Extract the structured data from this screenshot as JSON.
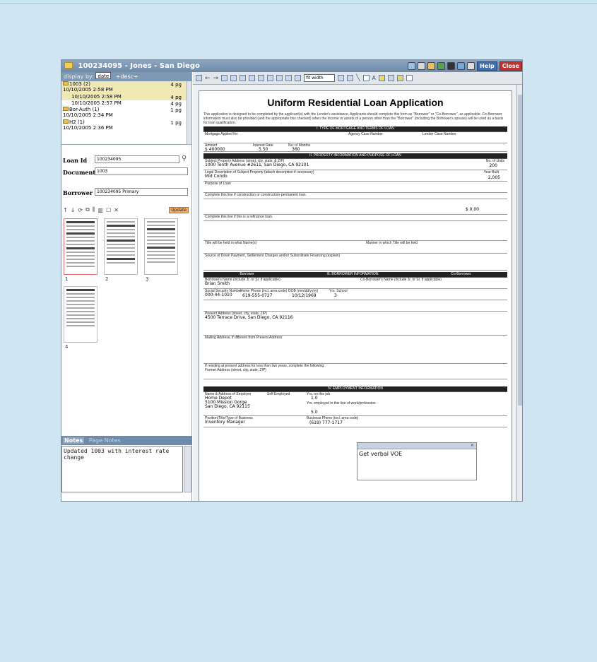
{
  "window": {
    "title": "100234095 - Jones - San Diego",
    "help_label": "Help",
    "close_label": "Close"
  },
  "display_bar": {
    "label": "display by:",
    "sort_value": "date",
    "order_label": "+desc+"
  },
  "documents": [
    {
      "name": "1003 (2)",
      "date": "10/10/2005 2:58 PM",
      "pages": "4 pg"
    },
    {
      "name": "10/10/2005 2:58 PM",
      "pages": "4 pg",
      "sub": true
    },
    {
      "name": "10/10/2005 2:57 PM",
      "pages": "4 pg",
      "sub": true
    },
    {
      "name": "Bor-Auth (1)",
      "date": "10/10/2005 2:34 PM",
      "pages": "1 pg"
    },
    {
      "name": "H2 (1)",
      "date": "10/10/2005 2:36 PM",
      "pages": "1 pg"
    }
  ],
  "loan_id": {
    "label": "Loan Id",
    "value": "100234095"
  },
  "document": {
    "label": "Document",
    "value": "1003"
  },
  "borrower": {
    "label": "Borrower",
    "value": "100234095 Primary"
  },
  "thumb_tools": {
    "update_label": "Update"
  },
  "thumbnails": [
    {
      "number": "1"
    },
    {
      "number": "2"
    },
    {
      "number": "3"
    },
    {
      "number": "4"
    }
  ],
  "notes": {
    "tab_notes": "Notes",
    "tab_page_notes": "Page Notes",
    "text": "Updated 1003 with interest rate change"
  },
  "viewer": {
    "fit_value": "fit width"
  },
  "form": {
    "title": "Uniform Residential Loan Application",
    "intro": "This application is designed to be completed by the applicant(s) with the Lender's assistance. Applicants should complete this form as \"Borrower\" or \"Co-Borrower\", as applicable. Co-Borrower information must also be provided (and the appropriate box checked) when the income or assets of a person other than the \"Borrower\" (including the Borrower's spouse) will be used as a basis for loan qualification.",
    "section1": "I. TYPE OF MORTGAGE AND TERMS OF LOAN",
    "mortgage_applied": "Mortgage Applied for:",
    "amount_label": "Amount",
    "amount": "$ 400000",
    "interest_rate_label": "Interest Rate",
    "interest_rate": "5.50",
    "months_label": "No. of Months",
    "months": "360",
    "agency_case": "Agency Case Number",
    "lender_case": "Lender Case Number",
    "section2": "II. PROPERTY INFORMATION AND PURPOSE OF LOAN",
    "subject_address_label": "Subject Property Address (street, city, state, & ZIP)",
    "subject_address": "1000 Tenth Avenue #2611, San Diego, CA 92101",
    "units_label": "No. of Units",
    "units": "200",
    "legal_label": "Legal Description of Subject Property (attach description if necessary)",
    "legal": "Mid Condo",
    "year_built_label": "Year Built",
    "year_built": "2,005",
    "purpose_label": "Purpose of Loan",
    "complete_line": "Complete this line if construction or construction-permanent loan.",
    "complete_refi": "Complete this line if this is a refinance loan.",
    "total": "$ 0.00",
    "title_held": "Title will be held in what Name(s)",
    "manner": "Manner in which Title will be held",
    "down_payment": "Source of Down Payment, Settlement Charges and/or Subordinate Financing (explain)",
    "section3": "III. BORROWER INFORMATION",
    "borrower_hd": "Borrower",
    "coborrower_hd": "Co-Borrower",
    "borrower_name_label": "Borrower's Name (include Jr. or Sr. if applicable)",
    "borrower_name": "Brian Smith",
    "coborrower_name_label": "Co-Borrower's Name (include Jr. or Sr. if applicable)",
    "ssn_label": "Social Security Number",
    "ssn": "000-44-1010",
    "home_phone_label": "Home Phone (incl. area code)",
    "home_phone": "619-555-0727",
    "dob_label": "DOB (mm/dd/yyyy)",
    "dob": "10/12/1969",
    "yrs_school_label": "Yrs. School",
    "yrs_school": "3",
    "present_address_label": "Present Address (street, city, state, ZIP)",
    "present_address": "4500 Terrace Drive, San Diego, CA 92116",
    "mailing_label": "Mailing Address, if different from Present Address",
    "former_label": "If residing at present address for less than two years, complete the following:",
    "former_address": "Former Address (street, city, state, ZIP)",
    "section4": "IV. EMPLOYMENT INFORMATION",
    "employer_label": "Name & Address of Employer",
    "employer": "Home Depot",
    "employer_addr1": "5100 Mission Gorge",
    "employer_addr2": "San Diego, CA 92115",
    "self_employed": "Self Employed",
    "yrs_job_label": "Yrs. on this job",
    "yrs_job": "1.0",
    "yrs_line_label": "Yrs. employed in this line of work/profession",
    "yrs_line": "5.0",
    "position_label": "Position/Title/Type of Business",
    "position": "Inventory Manager",
    "business_phone_label": "Business Phone (incl. area code)",
    "business_phone": "(619) 777-1717"
  },
  "popup_note": {
    "text": "Get verbal VOE"
  }
}
